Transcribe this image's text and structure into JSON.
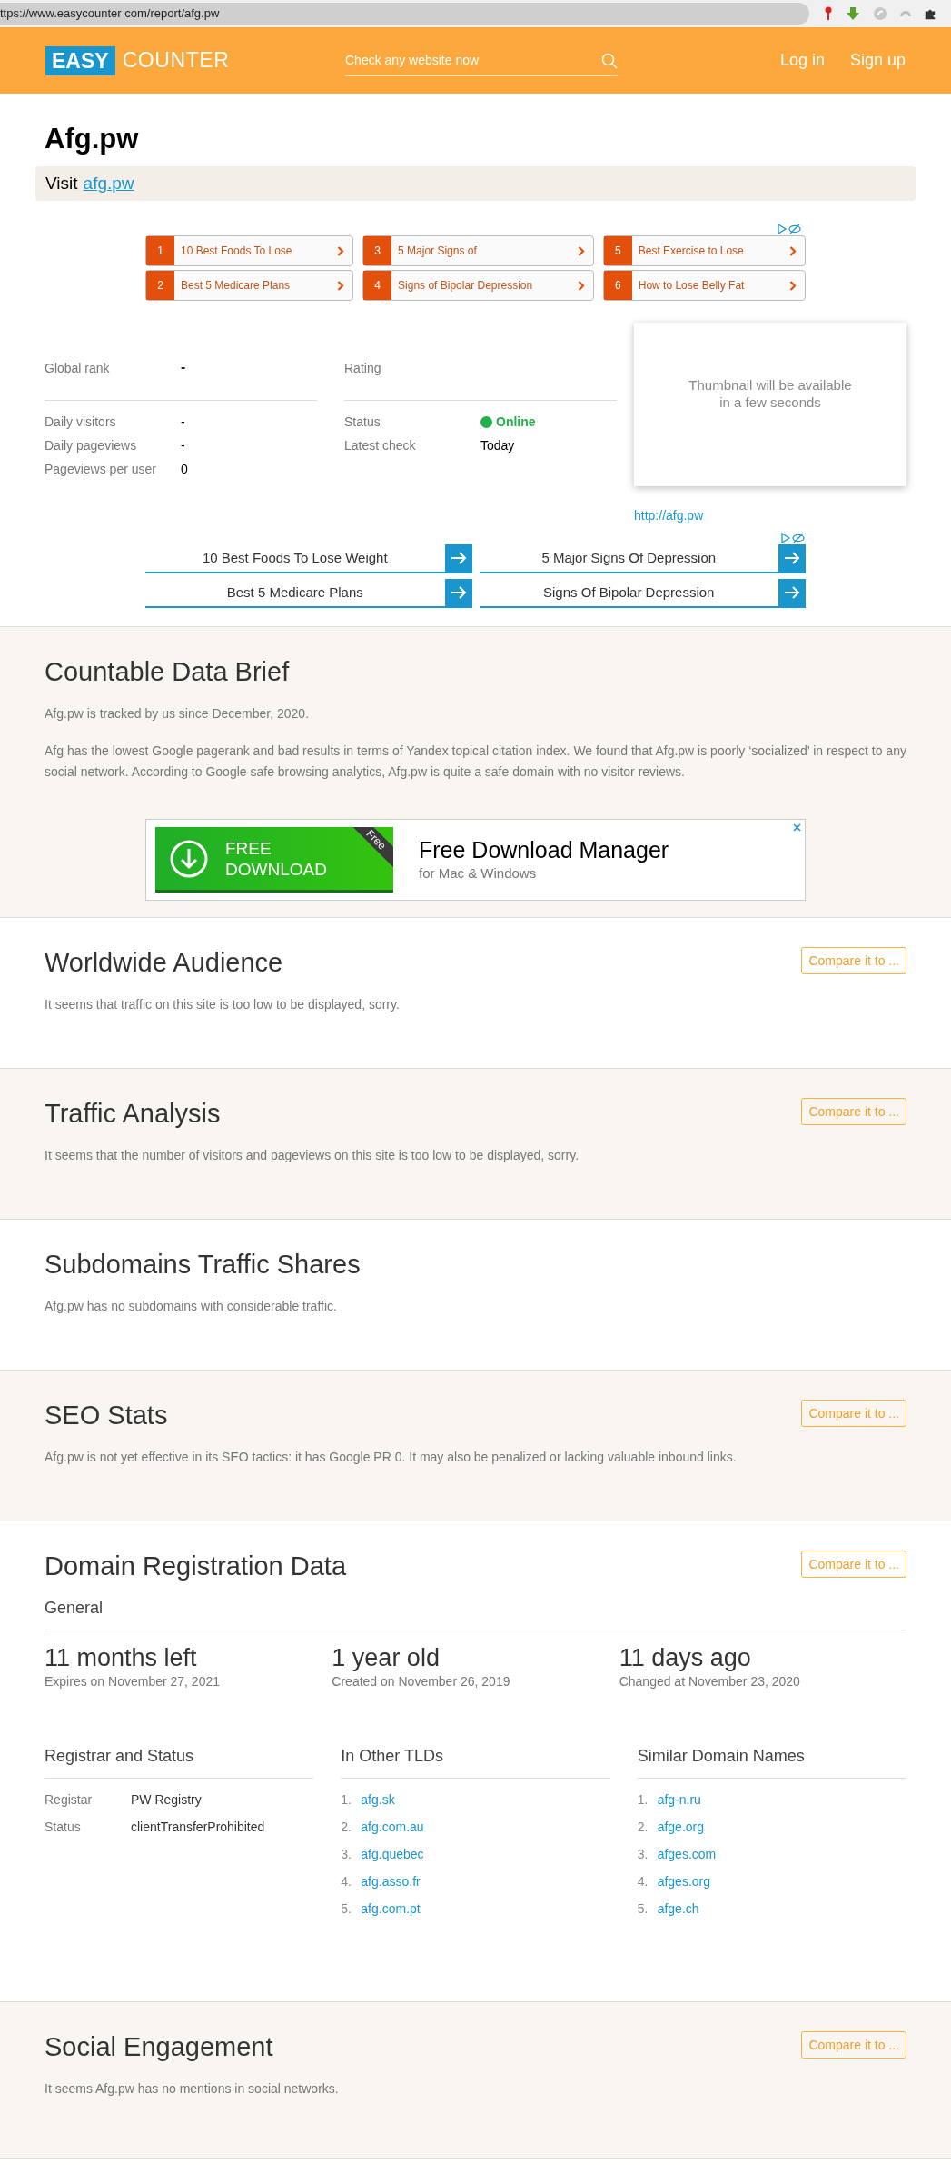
{
  "browser": {
    "url": "ttps://www.easycounter com/report/afg.pw"
  },
  "header": {
    "logo_box": "EASY",
    "logo_text": "COUNTER",
    "search_placeholder": "Check any website now",
    "links": [
      "Log in",
      "Sign up"
    ]
  },
  "site": {
    "title": "Afg.pw",
    "visit_label": "Visit",
    "visit_link": "afg.pw"
  },
  "ad_grid": [
    {
      "number": "1",
      "text": "10 Best Foods To Lose"
    },
    {
      "number": "2",
      "text": "Best 5 Medicare Plans"
    },
    {
      "number": "3",
      "text": "5 Major Signs of"
    },
    {
      "number": "4",
      "text": "Signs of Bipolar Depression"
    },
    {
      "number": "5",
      "text": "Best Exercise to Lose"
    },
    {
      "number": "6",
      "text": "How to Lose Belly Fat"
    }
  ],
  "stats": [
    {
      "top": {
        "label": "Global rank",
        "value": "-"
      },
      "rows": [
        {
          "label": "Daily visitors",
          "value": "-",
          "kind": "plain"
        },
        {
          "label": "Daily pageviews",
          "value": "-",
          "kind": "plain"
        },
        {
          "label": "Pageviews per user",
          "value": "0",
          "kind": "plain"
        }
      ]
    },
    {
      "top": {
        "label": "Rating"
      },
      "rows": [
        {
          "label": "Status",
          "value": "Online",
          "kind": "status",
          "color": "#22b04b"
        },
        {
          "label": "Latest check",
          "value": "Today",
          "kind": "plain"
        }
      ]
    }
  ],
  "thumbnail": {
    "message": "Thumbnail will be available\nin a few seconds",
    "link": "http://afg.pw"
  },
  "link_ads": [
    {
      "text": "10 Best Foods To Lose Weight"
    },
    {
      "text": "5 Major Signs Of Depression"
    },
    {
      "text": "Best 5 Medicare Plans"
    },
    {
      "text": "Signs Of Bipolar Depression"
    }
  ],
  "sections": [
    {
      "kind": "text",
      "title": "Countable Data Brief",
      "shaded": true,
      "paragraphs": [
        "Afg.pw is tracked by us since December, 2020.",
        "Afg has the lowest Google pagerank and bad results in terms of Yandex topical citation index. We found that Afg.pw is poorly ‘socialized’ in respect to any social network. According to Google safe browsing analytics, Afg.pw is quite a safe domain with no visitor reviews."
      ],
      "banner": {
        "button": "FREE\nDOWNLOAD",
        "corner": "Free",
        "title": "Free Download Manager",
        "subtitle": "for Mac & Windows"
      }
    },
    {
      "kind": "text",
      "title": "Worldwide Audience",
      "shaded": false,
      "compare_button": "Compare it to ...",
      "paragraphs": [
        "It seems that traffic on this site is too low to be displayed, sorry."
      ]
    },
    {
      "kind": "text",
      "title": "Traffic Analysis",
      "shaded": true,
      "compare_button": "Compare it to ...",
      "paragraphs": [
        "It seems that the number of visitors and pageviews on this site is too low to be displayed, sorry."
      ]
    },
    {
      "kind": "text",
      "title": "Subdomains Traffic Shares",
      "shaded": false,
      "paragraphs": [
        "Afg.pw has no subdomains with considerable traffic."
      ]
    },
    {
      "kind": "text",
      "title": "SEO Stats",
      "shaded": true,
      "compare_button": "Compare it to ...",
      "paragraphs": [
        "Afg.pw is not yet effective in its SEO tactics: it has Google PR 0. It may also be penalized or lacking valuable inbound links."
      ]
    },
    {
      "kind": "domain",
      "title": "Domain Registration Data",
      "shaded": false,
      "compare_button": "Compare it to ...",
      "general_title": "General",
      "facts": [
        {
          "value": "11 months left",
          "caption": "Expires on November 27, 2021"
        },
        {
          "value": "1 year old",
          "caption": "Created on November 26, 2019"
        },
        {
          "value": "11 days ago",
          "caption": "Changed at November 23, 2020"
        }
      ],
      "registrar": {
        "title": "Registrar and Status",
        "rows": [
          {
            "label": "Registar",
            "value": "PW Registry"
          },
          {
            "label": "Status",
            "value": "clientTransferProhibited"
          }
        ]
      },
      "lists": [
        {
          "title": "In Other TLDs",
          "items": [
            {
              "number": "1.",
              "text": "afg.sk"
            },
            {
              "number": "2.",
              "text": "afg.com.au"
            },
            {
              "number": "3.",
              "text": "afg.quebec"
            },
            {
              "number": "4.",
              "text": "afg.asso.fr"
            },
            {
              "number": "5.",
              "text": "afg.com.pt"
            }
          ]
        },
        {
          "title": "Similar Domain Names",
          "items": [
            {
              "number": "1.",
              "text": "afg-n.ru"
            },
            {
              "number": "2.",
              "text": "afge.org"
            },
            {
              "number": "3.",
              "text": "afges.com"
            },
            {
              "number": "4.",
              "text": "afges.org"
            },
            {
              "number": "5.",
              "text": "afge.ch"
            }
          ]
        }
      ]
    },
    {
      "kind": "text",
      "title": "Social Engagement",
      "shaded": true,
      "compare_button": "Compare it to ...",
      "paragraphs": [
        "It seems Afg.pw has no mentions in social networks."
      ]
    }
  ]
}
